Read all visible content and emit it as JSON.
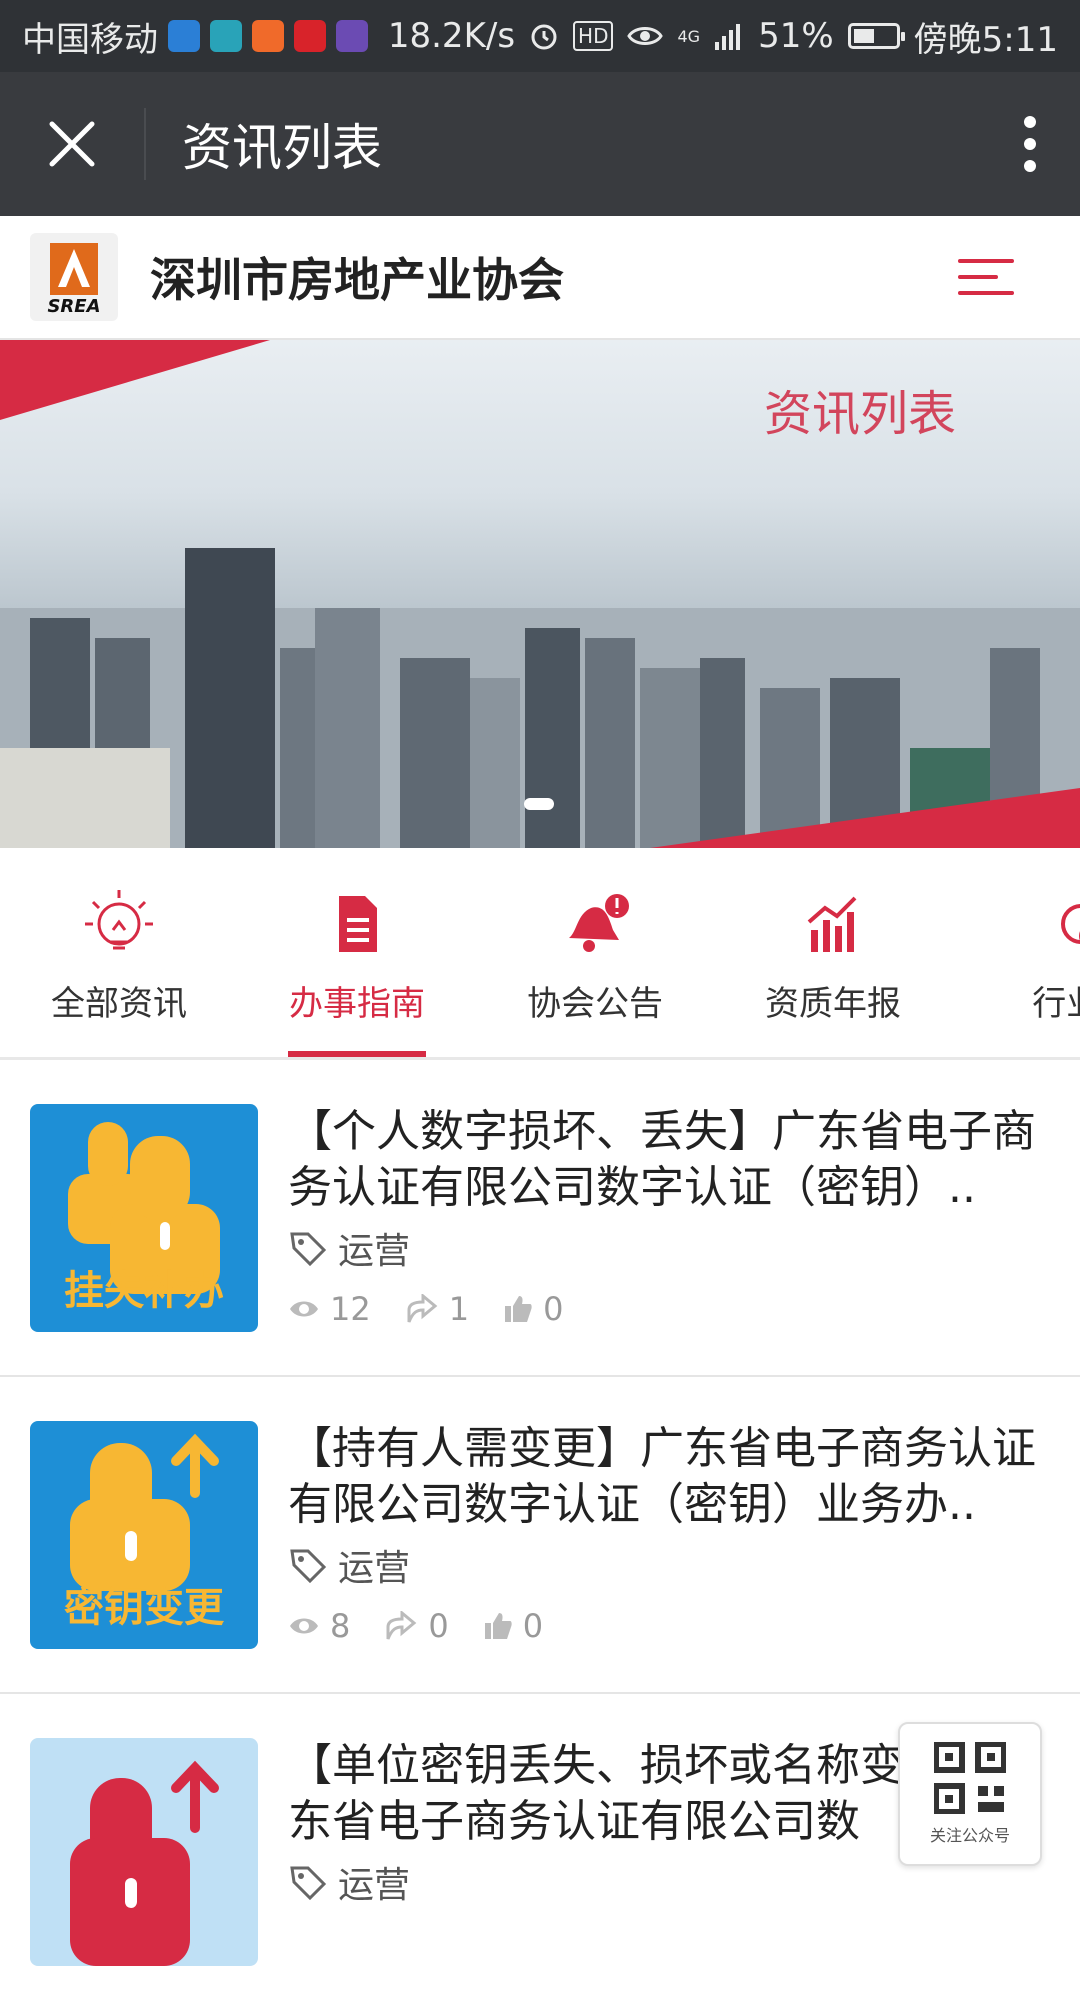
{
  "statusbar": {
    "carrier": "中国移动",
    "speed": "18.2K/s",
    "hd": "HD",
    "network": "4G",
    "battery": "51%",
    "battery_level": 0.51,
    "time": "傍晚5:11",
    "app_icons": [
      "shield-app-icon",
      "book-app-icon",
      "video-app-icon",
      "tmall-app-icon",
      "media-app-icon"
    ]
  },
  "titlebar": {
    "title": "资讯列表"
  },
  "site": {
    "logo_text": "SREA",
    "name": "深圳市房地产业协会"
  },
  "banner": {
    "title": "资讯列表",
    "accent_color": "#d62b44"
  },
  "tabs": [
    {
      "label": "全部资讯",
      "icon": "lightbulb-icon"
    },
    {
      "label": "办事指南",
      "icon": "document-icon",
      "active": true
    },
    {
      "label": "协会公告",
      "icon": "bell-icon"
    },
    {
      "label": "资质年报",
      "icon": "bar-chart-icon"
    },
    {
      "label": "行业i",
      "icon": "chat-icon"
    }
  ],
  "items": [
    {
      "title": "【个人数字损坏、丢失】广东省电子商务认证有限公司数字认证（密钥）..",
      "thumb_caption": "挂失补办",
      "tag": "运营",
      "views": "12",
      "shares": "1",
      "likes": "0"
    },
    {
      "title": "【持有人需变更】广东省电子商务认证有限公司数字认证（密钥）业务办..",
      "thumb_caption": "密钥变更",
      "tag": "运营",
      "views": "8",
      "shares": "0",
      "likes": "0"
    },
    {
      "title": "【单位密钥丢失、损坏或名称变更】广东省电子商务认证有限公司数",
      "thumb_caption": "",
      "tag": "运营",
      "views": "",
      "shares": "",
      "likes": ""
    }
  ],
  "qr": {
    "label": "关注公众号"
  }
}
